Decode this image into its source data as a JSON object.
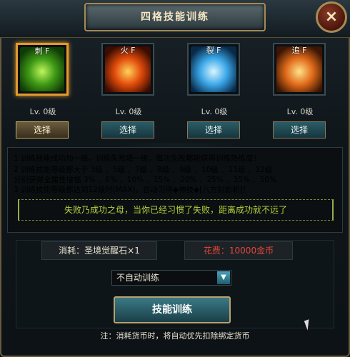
{
  "window": {
    "title": "四格技能训练",
    "close_icon": "×"
  },
  "skills": [
    {
      "tag": "刺 F",
      "level": "Lv. 0级",
      "button": "选择",
      "selected": true
    },
    {
      "tag": "火 F",
      "level": "Lv. 0级",
      "button": "选择",
      "selected": false
    },
    {
      "tag": "裂 F",
      "level": "Lv. 0级",
      "button": "选择",
      "selected": false
    },
    {
      "tag": "追 F",
      "level": "Lv. 0级",
      "button": "选择",
      "selected": false
    }
  ],
  "rules": {
    "line1": "1 训练技能成功加一级，训练失败降一级，每次失败都能获得训练熟练度！",
    "line2": "2 训练技能等级都大于  3级 、5级 、7级 、8级 、9级 、10级 、11级 、12级",
    "line3": "   分别获得全属性增幅  3% 、6% 、10% 、15% 、20% 、25% 、35% 、50%",
    "line4": "3 训练技能等级都达到12级时(MAX)，自动习得◆神技◆[八方封影斩]！"
  },
  "motto": "失败乃成功之母，当你已经习惯了失败，距离成功就不远了",
  "cost": {
    "material": "消耗：圣境觉醒石×1",
    "money": "花费：10000金币"
  },
  "auto_train": {
    "selected": "不自动训练"
  },
  "train_button": "技能训练",
  "note": "注：消耗货币时，将自动优先扣除绑定货币",
  "colors": {
    "accent_gold": "#c7a86a",
    "rule_text": "#e03a6a",
    "motto": "#b7d23a",
    "money": "#e8443a"
  }
}
